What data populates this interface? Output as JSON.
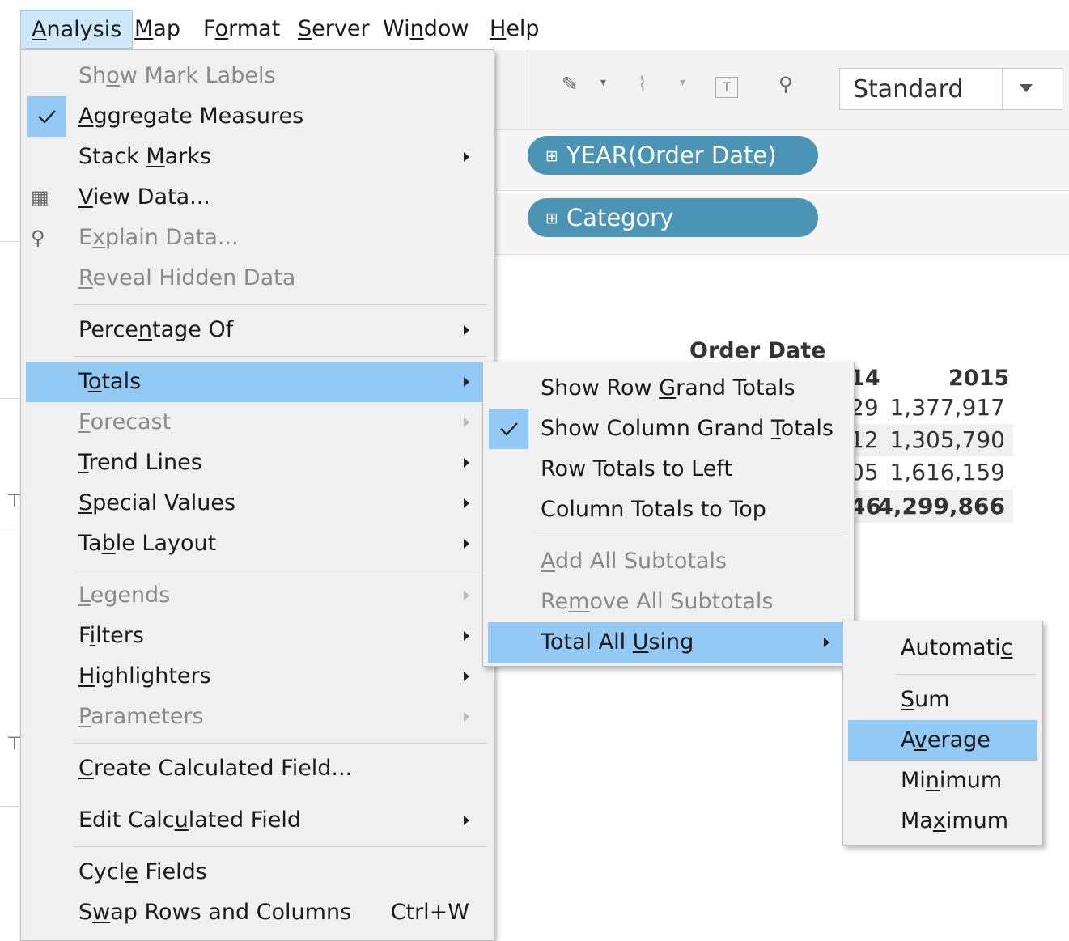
{
  "menubar": [
    {
      "pre": "",
      "key": "A",
      "post": "nalysis",
      "active": true
    },
    {
      "pre": "",
      "key": "M",
      "post": "ap",
      "active": false
    },
    {
      "pre": "F",
      "key": "o",
      "post": "rmat",
      "active": false
    },
    {
      "pre": "",
      "key": "S",
      "post": "erver",
      "active": false
    },
    {
      "pre": "Wi",
      "key": "n",
      "post": "dow",
      "active": false
    },
    {
      "pre": "",
      "key": "H",
      "post": "elp",
      "active": false
    }
  ],
  "toolbar": {
    "fit_value": "Standard"
  },
  "shelves": {
    "columns_pill": "YEAR(Order Date)",
    "rows_pill": "Category"
  },
  "crosstab": {
    "header": "Order Date",
    "col_partial": "14",
    "col_2015": "2015",
    "rows": [
      {
        "partial": "29",
        "value": "1,377,917"
      },
      {
        "partial": "12",
        "value": "1,305,790"
      },
      {
        "partial": "05",
        "value": "1,616,159"
      }
    ],
    "total": {
      "partial": "46",
      "value": "4,299,866"
    }
  },
  "analysis_menu": [
    {
      "pre": "Sh",
      "key": "o",
      "post": "w Mark Labels",
      "disabled": true
    },
    {
      "pre": "",
      "key": "A",
      "post": "ggregate Measures",
      "checked": true
    },
    {
      "pre": "Stack ",
      "key": "M",
      "post": "arks",
      "submenu": true
    },
    {
      "pre": "",
      "key": "V",
      "post": "iew Data...",
      "icon": "table-icon"
    },
    {
      "pre": "E",
      "key": "x",
      "post": "plain Data...",
      "icon": "lightbulb-icon",
      "disabled": true
    },
    {
      "pre": "",
      "key": "R",
      "post": "eveal Hidden Data",
      "disabled": true
    },
    {
      "sep": true
    },
    {
      "pre": "Perce",
      "key": "n",
      "post": "tage Of",
      "submenu": true
    },
    {
      "sep": true
    },
    {
      "pre": "T",
      "key": "o",
      "post": "tals",
      "submenu": true,
      "highlighted": true
    },
    {
      "pre": "",
      "key": "F",
      "post": "orecast",
      "submenu": true,
      "disabled": true
    },
    {
      "pre": "",
      "key": "T",
      "post": "rend Lines",
      "submenu": true
    },
    {
      "pre": "",
      "key": "S",
      "post": "pecial Values",
      "submenu": true
    },
    {
      "pre": "Ta",
      "key": "b",
      "post": "le Layout",
      "submenu": true
    },
    {
      "sep": true
    },
    {
      "pre": "",
      "key": "L",
      "post": "egends",
      "submenu": true,
      "disabled": true
    },
    {
      "pre": "F",
      "key": "i",
      "post": "lters",
      "submenu": true
    },
    {
      "pre": "",
      "key": "H",
      "post": "ighlighters",
      "submenu": true
    },
    {
      "pre": "",
      "key": "P",
      "post": "arameters",
      "submenu": true,
      "disabled": true
    },
    {
      "sep": true
    },
    {
      "pre": "",
      "key": "C",
      "post": "reate Calculated Field...",
      "sep_gap": 14
    },
    {
      "pre": "Edit Calc",
      "key": "u",
      "post": "lated Field",
      "submenu": true
    },
    {
      "sep": true
    },
    {
      "pre": "Cycl",
      "key": "e",
      "post": " Fields"
    },
    {
      "pre": "S",
      "key": "w",
      "post": "ap Rows and Columns",
      "shortcut": "Ctrl+W"
    }
  ],
  "totals_menu": [
    {
      "pre": "Show Row ",
      "key": "G",
      "post": "rand Totals"
    },
    {
      "pre": "Show Column Grand ",
      "key": "T",
      "post": "otals",
      "checked": true
    },
    {
      "pre": "Row Totals to Left",
      "key": "",
      "post": ""
    },
    {
      "pre": "Column Totals to Top",
      "key": "",
      "post": ""
    },
    {
      "sep": true
    },
    {
      "pre": "",
      "key": "A",
      "post": "dd All Subtotals",
      "disabled": true
    },
    {
      "pre": "Re",
      "key": "m",
      "post": "ove All Subtotals",
      "disabled": true
    },
    {
      "pre": "Total All ",
      "key": "U",
      "post": "sing",
      "submenu": true,
      "highlighted": true
    }
  ],
  "total_using_menu": [
    {
      "pre": "Automati",
      "key": "c",
      "post": ""
    },
    {
      "sep": true
    },
    {
      "pre": "",
      "key": "S",
      "post": "um"
    },
    {
      "pre": "A",
      "key": "v",
      "post": "erage",
      "highlighted": true
    },
    {
      "pre": "Mi",
      "key": "n",
      "post": "imum"
    },
    {
      "pre": "Ma",
      "key": "x",
      "post": "imum"
    }
  ]
}
